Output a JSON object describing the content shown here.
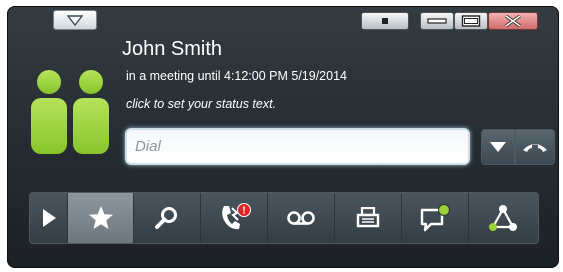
{
  "window": {
    "buttons": [
      "compact-view",
      "minimize",
      "maximize",
      "close"
    ]
  },
  "contact": {
    "name": "John Smith",
    "presence": "in a meeting until 4:12:00 PM 5/19/2014",
    "status_prompt": "click to set your status text."
  },
  "dial": {
    "placeholder": "Dial",
    "value": ""
  },
  "toolbar": {
    "items": [
      {
        "icon": "play-icon"
      },
      {
        "icon": "star-icon",
        "selected": true
      },
      {
        "icon": "search-icon"
      },
      {
        "icon": "call-history-icon",
        "badge": "!"
      },
      {
        "icon": "voicemail-icon"
      },
      {
        "icon": "fax-icon"
      },
      {
        "icon": "chat-icon",
        "presence": "online"
      },
      {
        "icon": "conference-icon"
      }
    ]
  },
  "colors": {
    "presence_green": "#9bd23a",
    "alert_red": "#e0262b",
    "window_bg": "#2b3237"
  }
}
